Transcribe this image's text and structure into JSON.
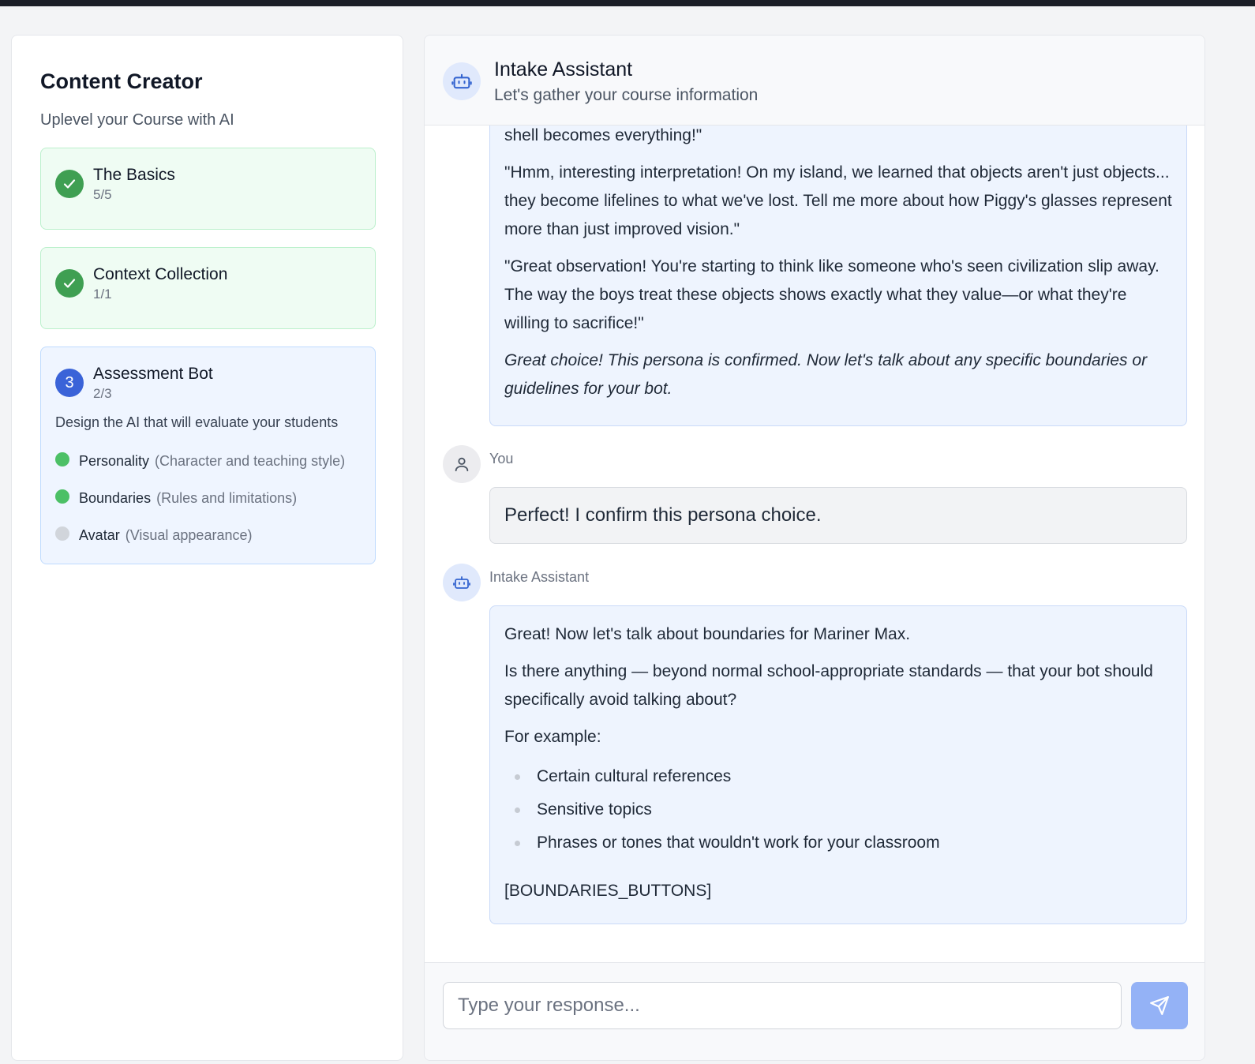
{
  "sidebar": {
    "title": "Content Creator",
    "subtitle": "Uplevel your Course with AI",
    "steps": [
      {
        "name": "The Basics",
        "count": "5/5",
        "status": "complete",
        "icon": "check-icon"
      },
      {
        "name": "Context Collection",
        "count": "1/1",
        "status": "complete",
        "icon": "check-icon"
      },
      {
        "number": "3",
        "name": "Assessment Bot",
        "count": "2/3",
        "status": "active",
        "description": "Design the AI that will evaluate your students",
        "substeps": [
          {
            "name": "Personality",
            "detail": "(Character and teaching style)",
            "done": true
          },
          {
            "name": "Boundaries",
            "detail": "(Rules and limitations)",
            "done": true
          },
          {
            "name": "Avatar",
            "detail": "(Visual appearance)",
            "done": false
          }
        ]
      }
    ]
  },
  "chat": {
    "header": {
      "title": "Intake Assistant",
      "subtitle": "Let's gather your course information",
      "icon": "bot-icon"
    },
    "messages": [
      {
        "sender": "Intake Assistant",
        "paragraphs": [
          "\"Wait, you think this conch is just a shell? Look closer! When you're stranded, a simple shell becomes everything!\"",
          "\"Hmm, interesting interpretation! On my island, we learned that objects aren't just objects... they become lifelines to what we've lost. Tell me more about how Piggy's glasses represent more than just improved vision.\"",
          "\"Great observation! You're starting to think like someone who's seen civilization slip away. The way the boys treat these objects shows exactly what they value—or what they're willing to sacrifice!\""
        ],
        "italic": "Great choice! This persona is confirmed. Now let's talk about any specific boundaries or guidelines for your bot."
      },
      {
        "sender": "You",
        "text": "Perfect! I confirm this persona choice.",
        "icon": "user-icon"
      },
      {
        "sender": "Intake Assistant",
        "icon": "bot-icon",
        "intro": "Great! Now let's talk about boundaries for Mariner Max.",
        "question": "Is there anything — beyond normal school-appropriate standards — that your bot should specifically avoid talking about?",
        "example_label": "For example:",
        "examples": [
          "Certain cultural references",
          "Sensitive topics",
          "Phrases or tones that wouldn't work for your classroom"
        ],
        "placeholder_token": "[BOUNDARIES_BUTTONS]"
      }
    ],
    "input": {
      "placeholder": "Type your response...",
      "value": ""
    },
    "send_icon": "send-icon"
  },
  "colors": {
    "accent": "#3a63d8",
    "complete": "#3f9f52",
    "send_button": "#94b2f6"
  }
}
